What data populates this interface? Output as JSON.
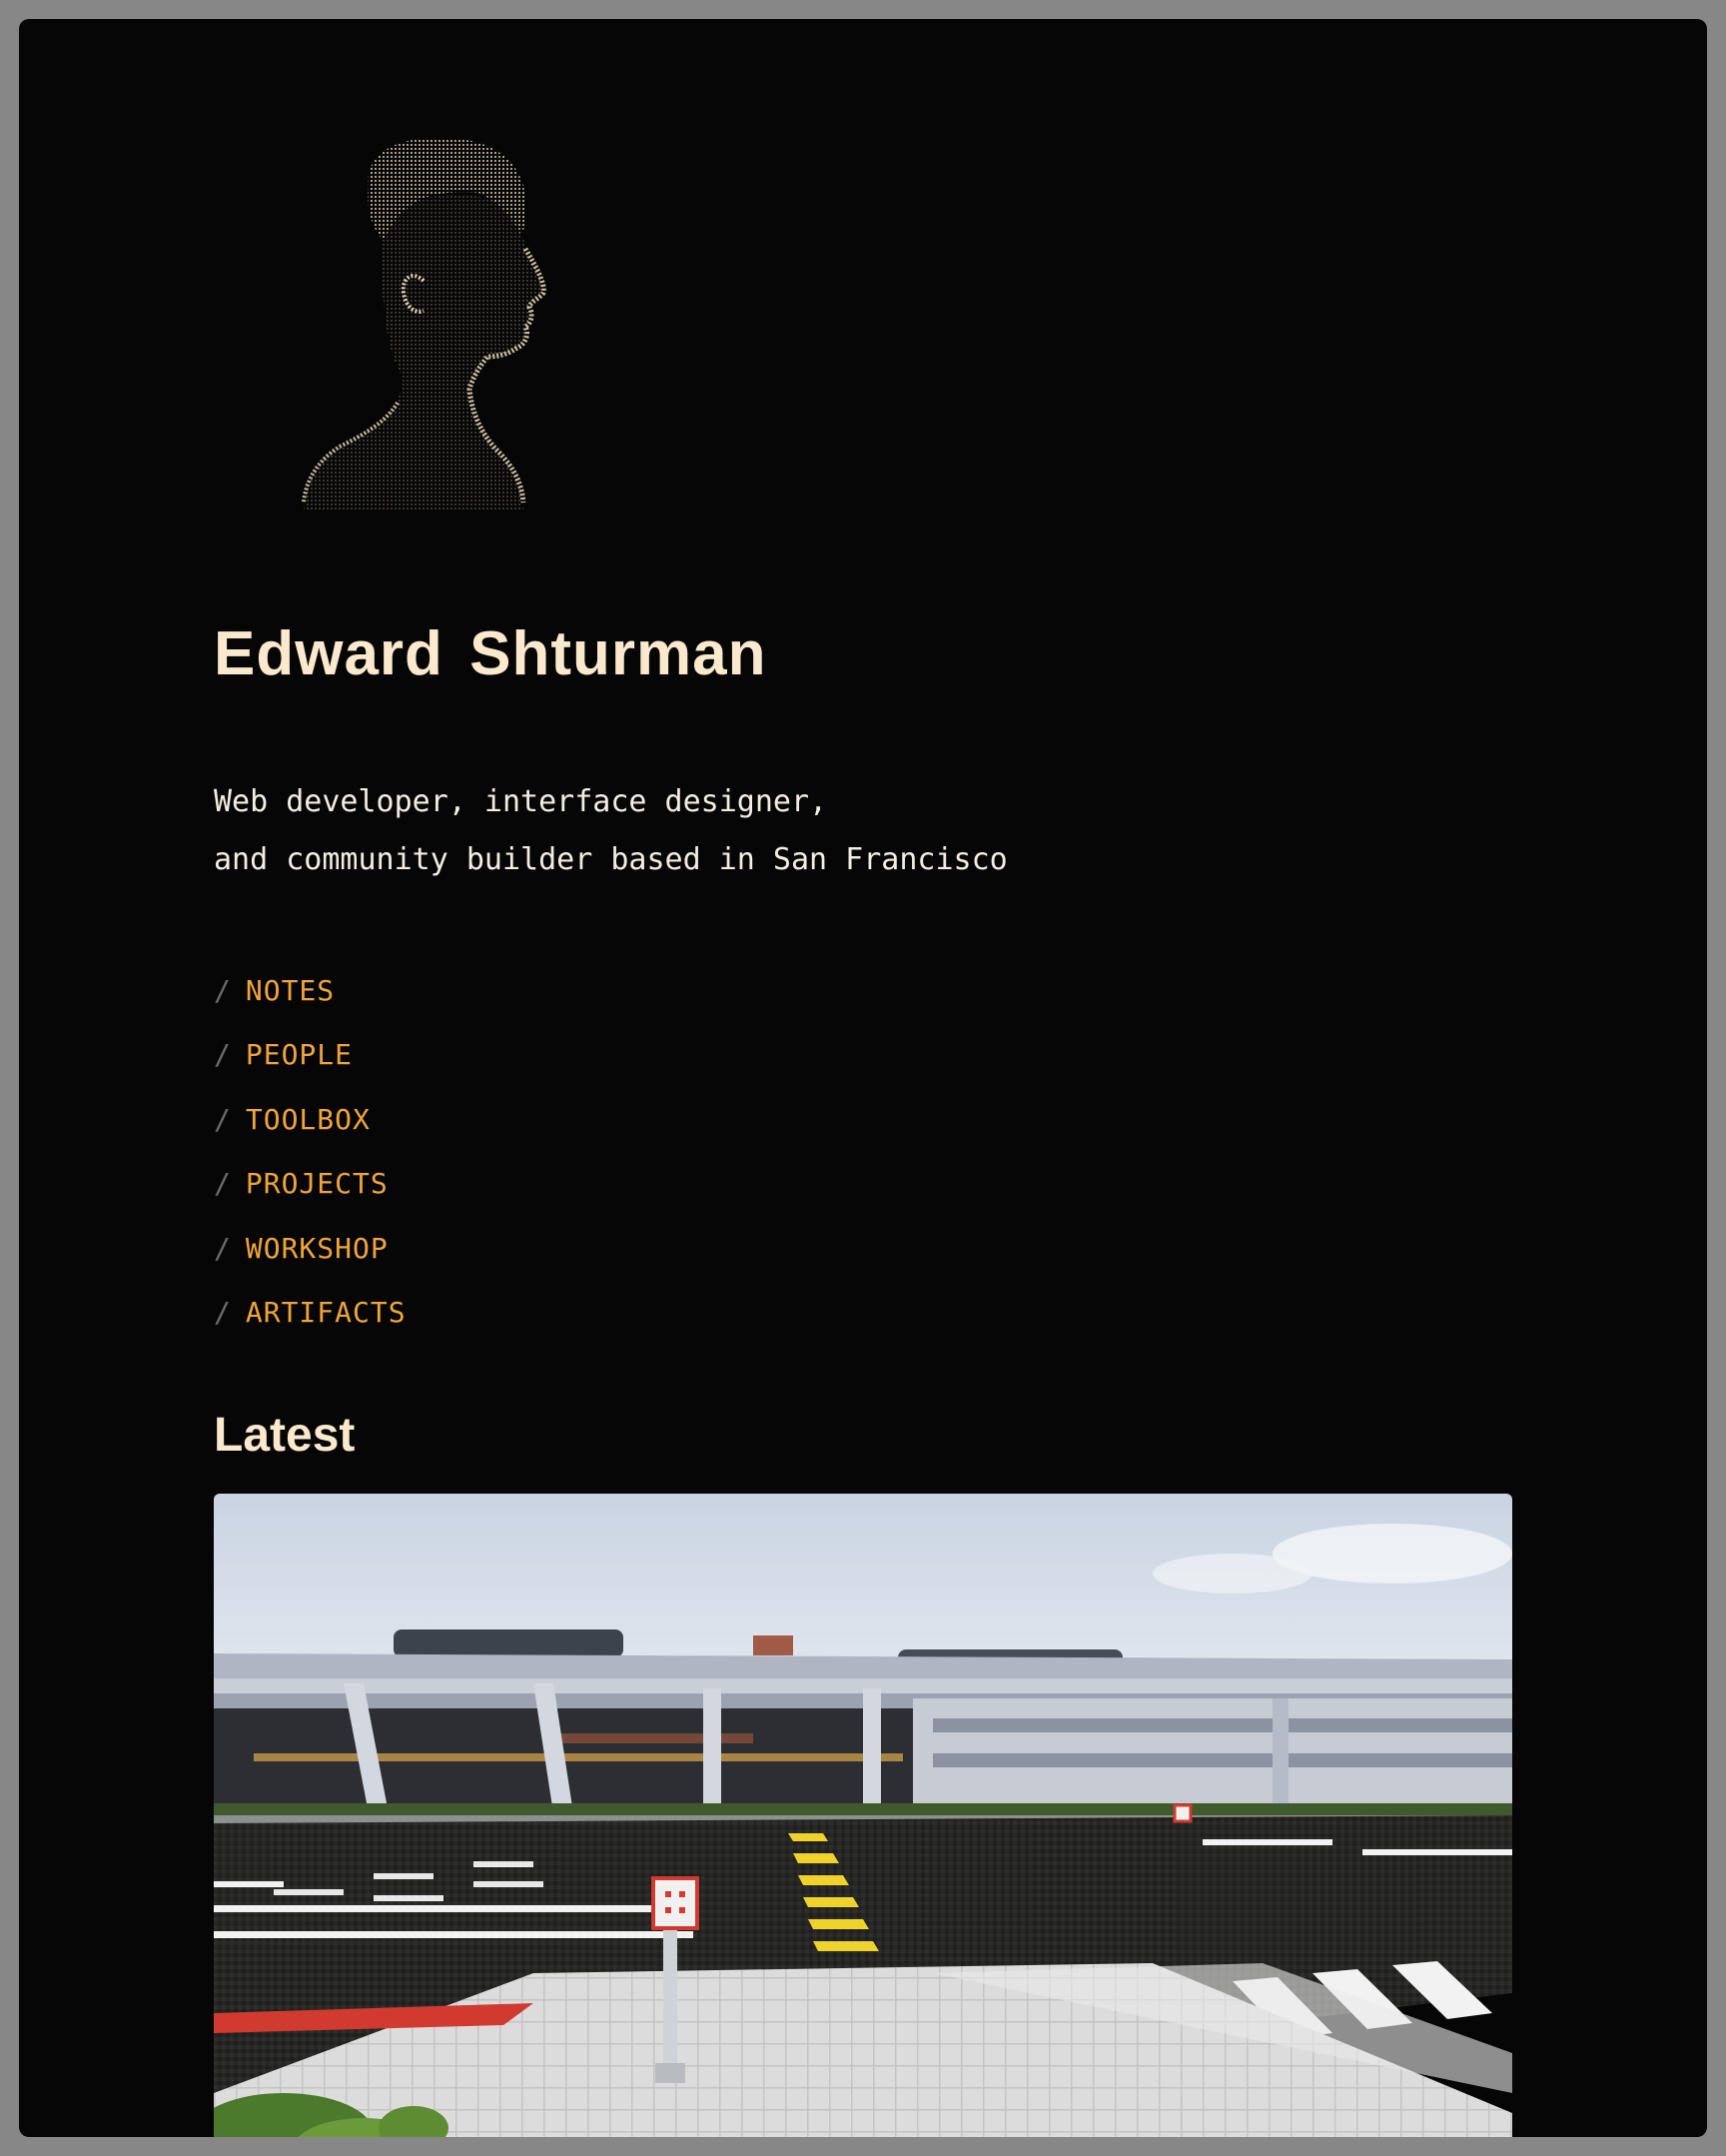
{
  "profile": {
    "name": "Edward Shturman",
    "bio_line_1": "Web developer, interface designer,",
    "bio_line_2": "and community builder based in San Francisco",
    "avatar_icon": "profile-silhouette-halftone"
  },
  "nav": {
    "separator": "/",
    "items": [
      {
        "label": "NOTES"
      },
      {
        "label": "PEOPLE"
      },
      {
        "label": "TOOLBOX"
      },
      {
        "label": "PROJECTS"
      },
      {
        "label": "WORKSHOP"
      },
      {
        "label": "ARTIFACTS"
      }
    ]
  },
  "latest": {
    "heading": "Latest"
  },
  "colors": {
    "background": "#060607",
    "heading": "#fbe9cd",
    "text": "#f4ede2",
    "link": "#f0a53a",
    "separator": "#6d6a66",
    "frame": "#878787"
  }
}
